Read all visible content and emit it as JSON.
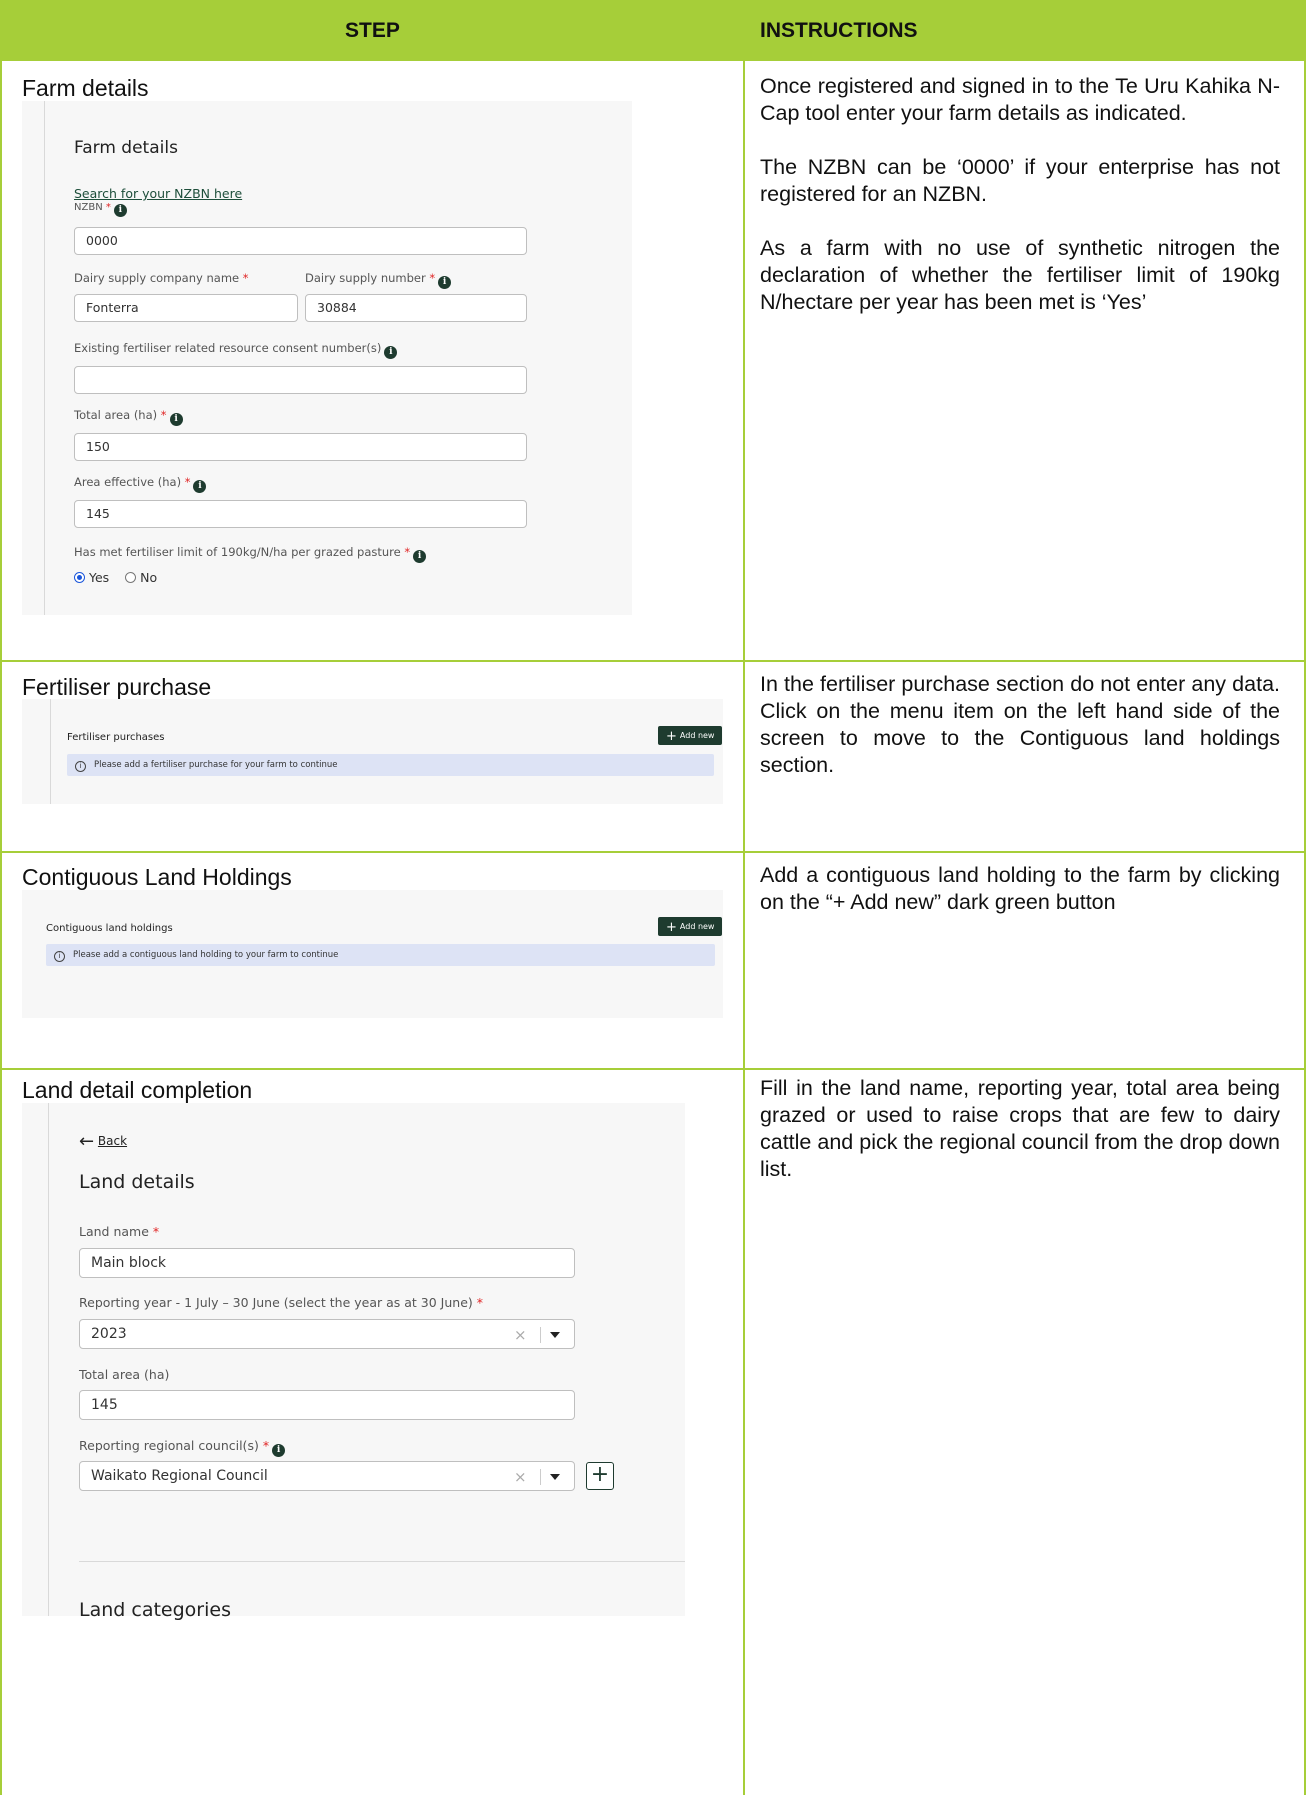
{
  "table_header": {
    "step": "STEP",
    "instructions": "INSTRUCTIONS"
  },
  "rows": [
    {
      "step": "Farm details",
      "instructions": [
        "Once registered and signed in to the Te Uru Kahika N-Cap tool enter your farm details as indicated.",
        "The NZBN can be ‘0000’ if your enterprise has not registered for an NZBN.",
        "As a farm with no use of synthetic nitrogen the declaration of whether the fertiliser limit of 190kg N/hectare per year has been met is ‘Yes’"
      ]
    },
    {
      "step": "Fertiliser purchase",
      "instructions": [
        "In the fertiliser purchase section do not enter any data. Click on the menu item on the left hand side of the screen to move to the Contiguous land holdings section."
      ]
    },
    {
      "step": "Contiguous Land Holdings",
      "instructions": [
        "Add a contiguous land holding to the farm by clicking on the “+ Add new” dark green button"
      ]
    },
    {
      "step": "Land detail completion",
      "instructions": [
        "Fill in the land name, reporting year, total area being grazed or used to raise crops that are few to dairy cattle and pick the regional council from the drop down list."
      ]
    }
  ],
  "farm_form": {
    "heading": "Farm details",
    "nzbn_link": "Search for your NZBN here",
    "nzbn_label": "NZBN",
    "nzbn_value": "0000",
    "dairy_company_label": "Dairy supply company name",
    "dairy_company_value": "Fonterra",
    "dairy_number_label": "Dairy supply number",
    "dairy_number_value": "30884",
    "consent_label": "Existing fertiliser related resource consent number(s)",
    "consent_value": "",
    "total_area_label": "Total area (ha)",
    "total_area_value": "150",
    "effective_area_label": "Area effective (ha)",
    "effective_area_value": "145",
    "limit_label": "Has met fertiliser limit of 190kg/N/ha per grazed pasture",
    "opt_yes": "Yes",
    "opt_no": "No",
    "selected": "Yes",
    "required_mark": "*",
    "info_glyph": "i"
  },
  "fert_panel": {
    "heading": "Fertiliser purchases",
    "add_button": "Add new",
    "alert": "Please add a fertiliser purchase for your farm to continue"
  },
  "cl_panel": {
    "heading": "Contiguous land holdings",
    "add_button": "Add new",
    "alert": "Please add a contiguous land holding to your farm to continue"
  },
  "land_form": {
    "back": "Back",
    "heading": "Land details",
    "land_name_label": "Land name",
    "land_name_value": "Main block",
    "year_label": "Reporting year - 1 July – 30 June (select the year as at 30 June)",
    "year_value": "2023",
    "total_area_label": "Total area (ha)",
    "total_area_value": "145",
    "council_label": "Reporting regional council(s)",
    "council_value": "Waikato Regional Council",
    "categories_heading": "Land categories"
  },
  "colors": {
    "header_bg": "#a6ce39",
    "grid": "#a6ce39",
    "button": "#1e3b2f",
    "alert_bg": "#dde3f5",
    "required": "#e02424"
  }
}
